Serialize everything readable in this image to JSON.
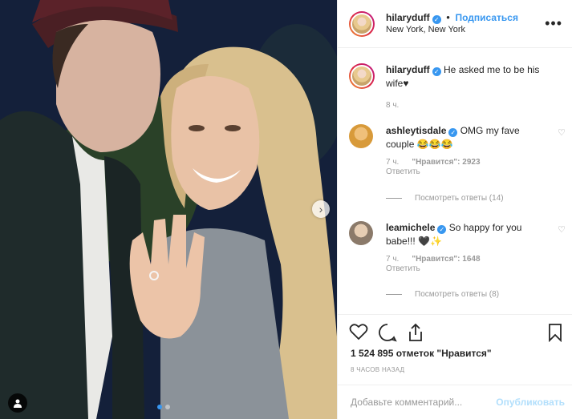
{
  "post": {
    "username": "hilaryduff",
    "verified_badge": "✓",
    "dot": "•",
    "follow_label": "Подписаться",
    "location": "New York, New York",
    "more_icon": "more-options-icon"
  },
  "caption": {
    "username": "hilaryduff",
    "text": "He asked me to be his wife♥",
    "time": "8 ч."
  },
  "comments": [
    {
      "username": "ashleytisdale",
      "text": "OMG my fave couple 😂😂😂",
      "time": "7 ч.",
      "likes_label": "\"Нравится\": 2923",
      "reply_label": "Ответить",
      "view_replies": "Посмотреть ответы (14)"
    },
    {
      "username": "leamichele",
      "text": "So happy for you babe!!! 🖤✨",
      "time": "7 ч.",
      "likes_label": "\"Нравится\": 1648",
      "reply_label": "Ответить",
      "view_replies": "Посмотреть ответы (8)"
    }
  ],
  "actions": {
    "likes": "1 524 895 отметок \"Нравится\"",
    "posted_ago": "8 ЧАСОВ НАЗАД"
  },
  "add_comment": {
    "placeholder": "Добавьте комментарий...",
    "publish_label": "Опубликовать"
  },
  "media": {
    "next_arrow": "›",
    "carousel_count": 2,
    "carousel_active": 0
  },
  "colors": {
    "accent": "#3897f0",
    "publish_disabled": "#b2dffc",
    "muted_text": "#999999"
  }
}
